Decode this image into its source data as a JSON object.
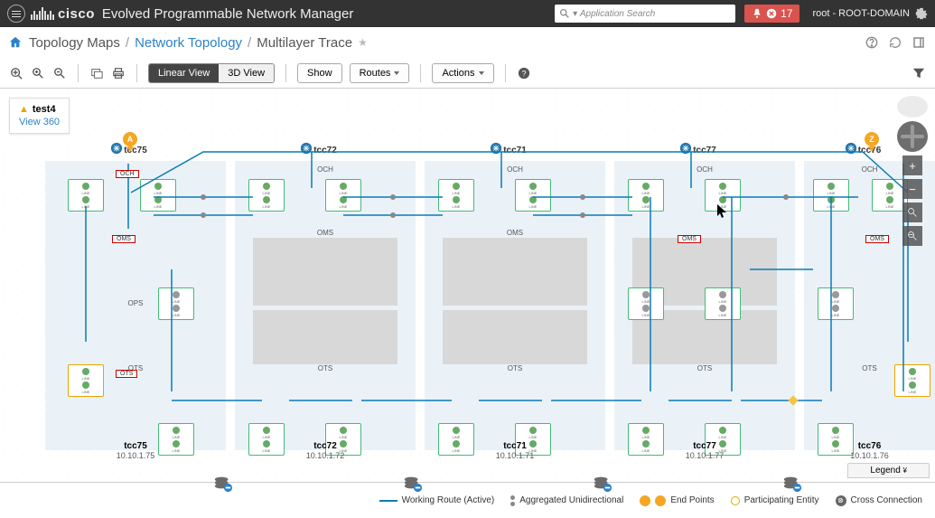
{
  "header": {
    "brand": "cisco",
    "product": "Evolved Programmable Network Manager",
    "search_placeholder": "Application Search",
    "alert_count": "17",
    "user": "root - ROOT-DOMAIN"
  },
  "breadcrumb": {
    "item1": "Topology Maps",
    "item2": "Network Topology",
    "item3": "Multilayer Trace"
  },
  "toolbar": {
    "linear": "Linear View",
    "threeD": "3D View",
    "show": "Show",
    "routes": "Routes",
    "actions": "Actions"
  },
  "info": {
    "title": "test4",
    "link": "View 360"
  },
  "layers": {
    "och": "OCH",
    "oms": "OMS",
    "ops": "OPS",
    "ots": "OTS"
  },
  "nodes": [
    {
      "name": "tcc75",
      "ip": "10.10.1.75"
    },
    {
      "name": "tcc72",
      "ip": "10.10.1.72"
    },
    {
      "name": "tcc71",
      "ip": "10.10.1.71"
    },
    {
      "name": "tcc77",
      "ip": "10.10.1.77"
    },
    {
      "name": "tcc76",
      "ip": "10.10.1.76"
    }
  ],
  "pin_a": "A",
  "pin_z": "Z",
  "redboxes": {
    "och": "OCH",
    "oms": "OMS",
    "ots": "OTS"
  },
  "legend": {
    "tab": "Legend",
    "working": "Working Route (Active)",
    "agg": "Aggregated Unidirectional",
    "endpoints": "End Points",
    "participating": "Participating Entity",
    "cross": "Cross Connection"
  }
}
